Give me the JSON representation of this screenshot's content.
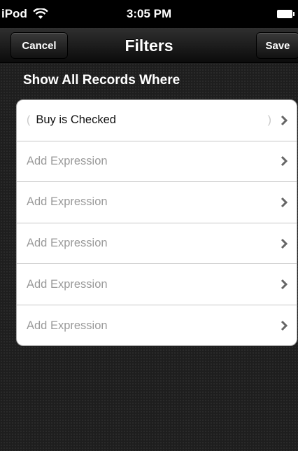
{
  "status_bar": {
    "carrier": "iPod",
    "time": "3:05 PM"
  },
  "nav": {
    "title": "Filters",
    "cancel_label": "Cancel",
    "save_label": "Save"
  },
  "section": {
    "header": "Show All Records Where"
  },
  "rows": [
    {
      "open_paren": "(",
      "text": "Buy is Checked",
      "close_paren": ")"
    },
    {
      "text": "Add Expression"
    },
    {
      "text": "Add Expression"
    },
    {
      "text": "Add Expression"
    },
    {
      "text": "Add Expression"
    },
    {
      "text": "Add Expression"
    }
  ]
}
